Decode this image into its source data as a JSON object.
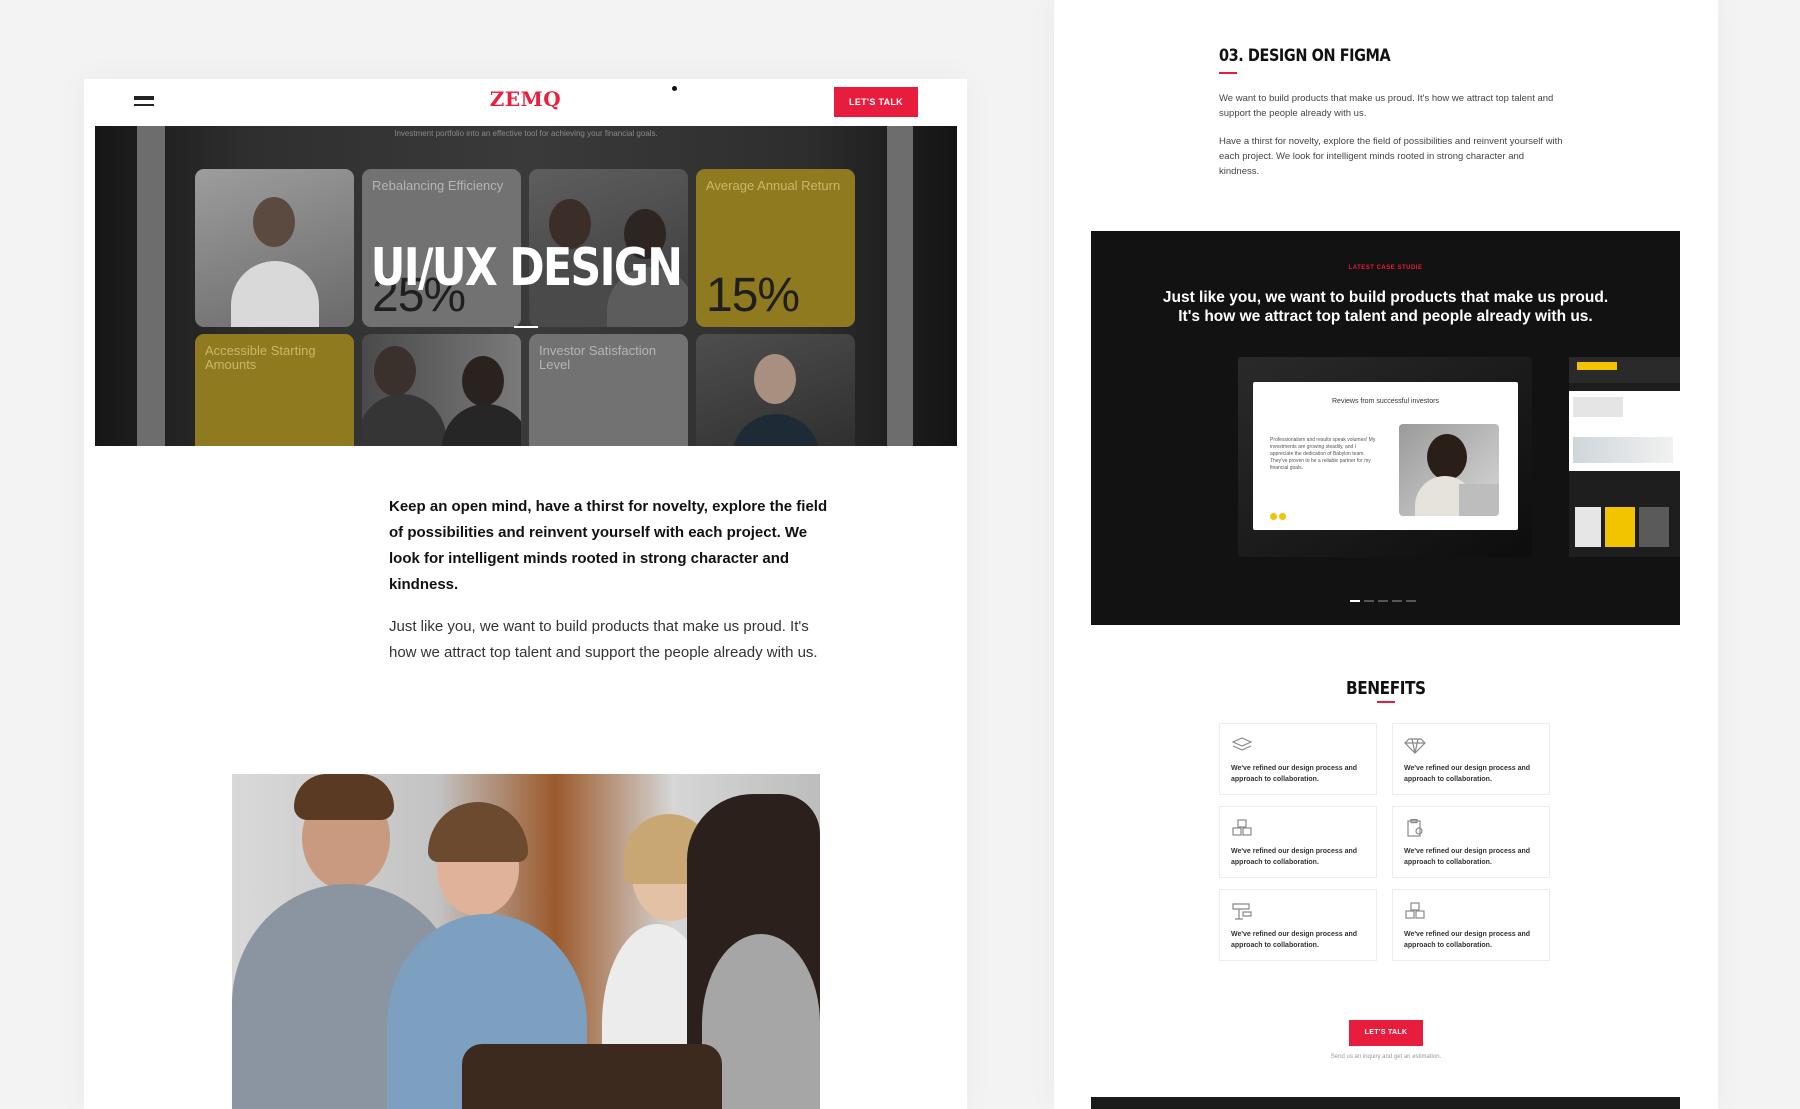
{
  "left": {
    "logo": "ZEMQ",
    "cta_label": "LET'S TALK",
    "hero": {
      "caption": "Investment portfolio into an effective tool for achieving your financial goals.",
      "title": "UI/UX DESIGN",
      "tiles": [
        {
          "label": "Rebalancing Efficiency",
          "value": "25%"
        },
        {
          "label": "Average Annual Return",
          "value": "15%"
        },
        {
          "label": "Accessible Starting Amounts"
        },
        {
          "label": "Investor Satisfaction Level"
        }
      ]
    },
    "intro_strong": "Keep an open mind, have a thirst for novelty, explore the field of possibilities and reinvent yourself with each project. We look for intelligent minds rooted in strong character and kindness.",
    "intro_body": "Just like you, we want to build products that make us proud. It's how we attract top talent and support the people already with us."
  },
  "right": {
    "section_title": "03. DESIGN ON FIGMA",
    "p1": "We want to build products that make us proud. It's how we attract top talent and support the people already with us.",
    "p2": "Have a thirst for novelty, explore the field of possibilities and reinvent yourself with each project. We look for intelligent minds rooted in strong character and kindness.",
    "case_study": {
      "tag": "LATEST CASE STUDIE",
      "headline": "Just like you, we want to build products that make us proud. It's how we attract top talent and people already with us.",
      "mock_title": "Reviews from successful investors",
      "mock_text": "Professionalism and results speak volumes! My investments are growing steadily, and I appreciate the dedication of Babylon team. They've proven to be a reliable partner for my financial goals."
    },
    "benefits_title": "BENEFITS",
    "benefits": [
      {
        "icon": "layers-icon",
        "text": "We've refined our design process and approach to collaboration."
      },
      {
        "icon": "diamond-icon",
        "text": "We've refined our design process and approach to collaboration."
      },
      {
        "icon": "boxes-icon",
        "text": "We've refined our design process and approach to collaboration."
      },
      {
        "icon": "clipboard-icon",
        "text": "We've refined our design process and approach to collaboration."
      },
      {
        "icon": "signpost-icon",
        "text": "We've refined our design process and approach to collaboration."
      },
      {
        "icon": "boxes-icon",
        "text": "We've refined our design process and approach to collaboration."
      }
    ],
    "cta_label": "LET'S TALK",
    "cta_sub": "Send us an inquiry and get an estimation."
  },
  "colors": {
    "accent": "#e81c3c",
    "dark": "#121212",
    "yellow": "#f2c400"
  }
}
